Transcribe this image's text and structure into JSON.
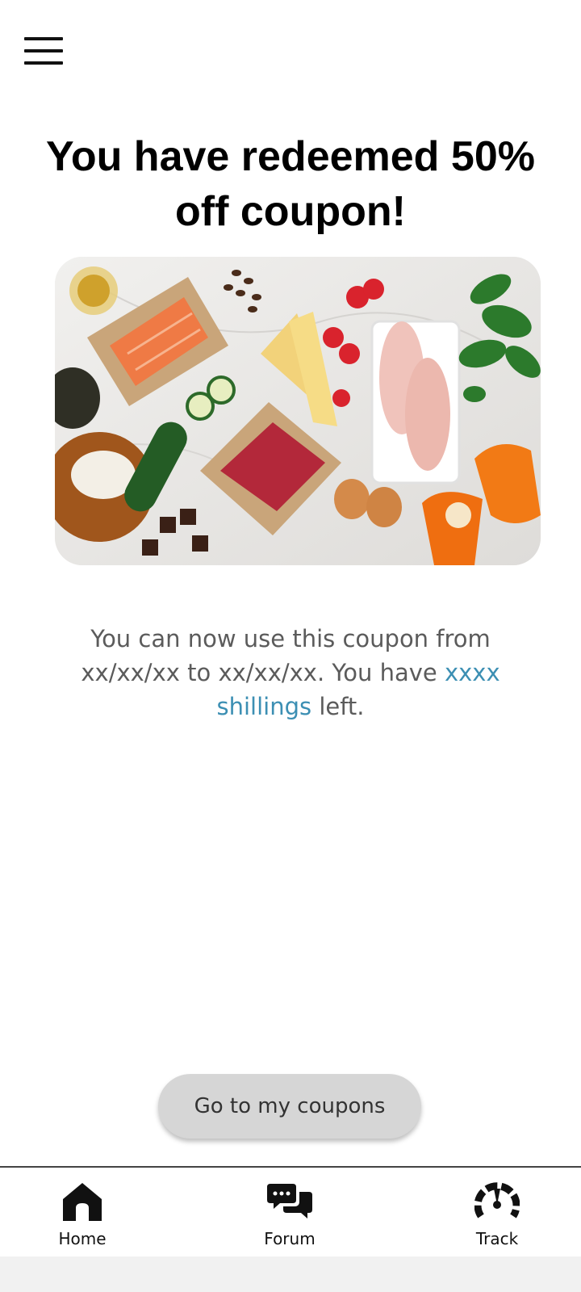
{
  "header": {
    "menu_icon": "hamburger-menu-icon"
  },
  "title": "You have redeemed 50% off coupon!",
  "hero_image": {
    "description": "food-spread-image"
  },
  "message": {
    "before": "You can now use this coupon from xx/xx/xx to xx/xx/xx. You have ",
    "highlight": "xxxx shillings",
    "after": " left."
  },
  "cta_label": "Go to my coupons",
  "nav": {
    "items": [
      {
        "label": "Home",
        "icon": "home-icon"
      },
      {
        "label": "Forum",
        "icon": "chat-bubbles-icon"
      },
      {
        "label": "Track",
        "icon": "gauge-icon"
      }
    ]
  },
  "colors": {
    "accent": "#3c8fb3",
    "button_bg": "#d6d6d6",
    "text_muted": "#5b5b5b"
  }
}
